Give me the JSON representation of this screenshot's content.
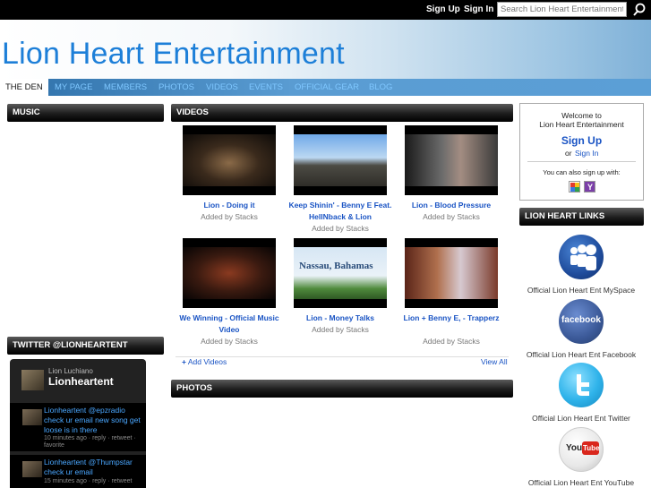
{
  "topbar": {
    "signup": "Sign Up",
    "signin": "Sign In",
    "search_placeholder": "Search Lion Heart Entertainment"
  },
  "site": {
    "title": "Lion Heart Entertainment"
  },
  "nav": [
    {
      "label": "THE DEN"
    },
    {
      "label": "MY PAGE"
    },
    {
      "label": "MEMBERS"
    },
    {
      "label": "PHOTOS"
    },
    {
      "label": "VIDEOS"
    },
    {
      "label": "EVENTS"
    },
    {
      "label": "OFFICIAL GEAR"
    },
    {
      "label": "BLOG"
    }
  ],
  "music": {
    "title": "MUSIC"
  },
  "videos": {
    "title": "VIDEOS",
    "items": [
      {
        "title": "Lion - Doing it",
        "by": "Added by Stacks"
      },
      {
        "title": "Keep Shinin' - Benny E Feat. HellNback & Lion",
        "by": "Added by Stacks"
      },
      {
        "title": "Lion - Blood Pressure",
        "by": "Added by Stacks"
      },
      {
        "title": "We Winning - Official Music Video",
        "by": "Added by Stacks"
      },
      {
        "title": "Lion - Money Talks",
        "by": "Added by Stacks"
      },
      {
        "title": "Lion + Benny E, - Trapperz",
        "by": "Added by Stacks"
      }
    ],
    "add": "Add Videos",
    "viewall": "View All",
    "thumb5_text": "Nassau, Bahamas"
  },
  "photos": {
    "title": "PHOTOS"
  },
  "welcome": {
    "line1": "Welcome to",
    "line2": "Lion Heart Entertainment",
    "signup": "Sign Up",
    "or": "or",
    "signin": "Sign In",
    "also": "You can also sign up with:"
  },
  "links": {
    "title": "LION HEART LINKS",
    "items": [
      {
        "label": "Official Lion Heart Ent MySpace"
      },
      {
        "label": "Official Lion Heart Ent Facebook",
        "icon_text": "facebook"
      },
      {
        "label": "Official Lion Heart Ent Twitter"
      },
      {
        "label": "Official Lion Heart Ent YouTube",
        "icon_text": "You",
        "icon_text2": "Tube"
      }
    ]
  },
  "twitter": {
    "title": "TWITTER @LIONHEARTENT",
    "profile_name": "Lion Luchiano",
    "profile_handle": "Lionheartent",
    "tweets": [
      {
        "text": "Lionheartent @epzradio check ur email new song get loose is in there",
        "meta": "10 minutes ago · reply · retweet · favorite"
      },
      {
        "text": "Lionheartent @Thumpstar check ur email",
        "meta": "15 minutes ago · reply · retweet"
      }
    ]
  },
  "colors": {
    "accent": "#1d7fd8",
    "link": "#1a54c4",
    "nav_text": "#7fc7ff"
  }
}
